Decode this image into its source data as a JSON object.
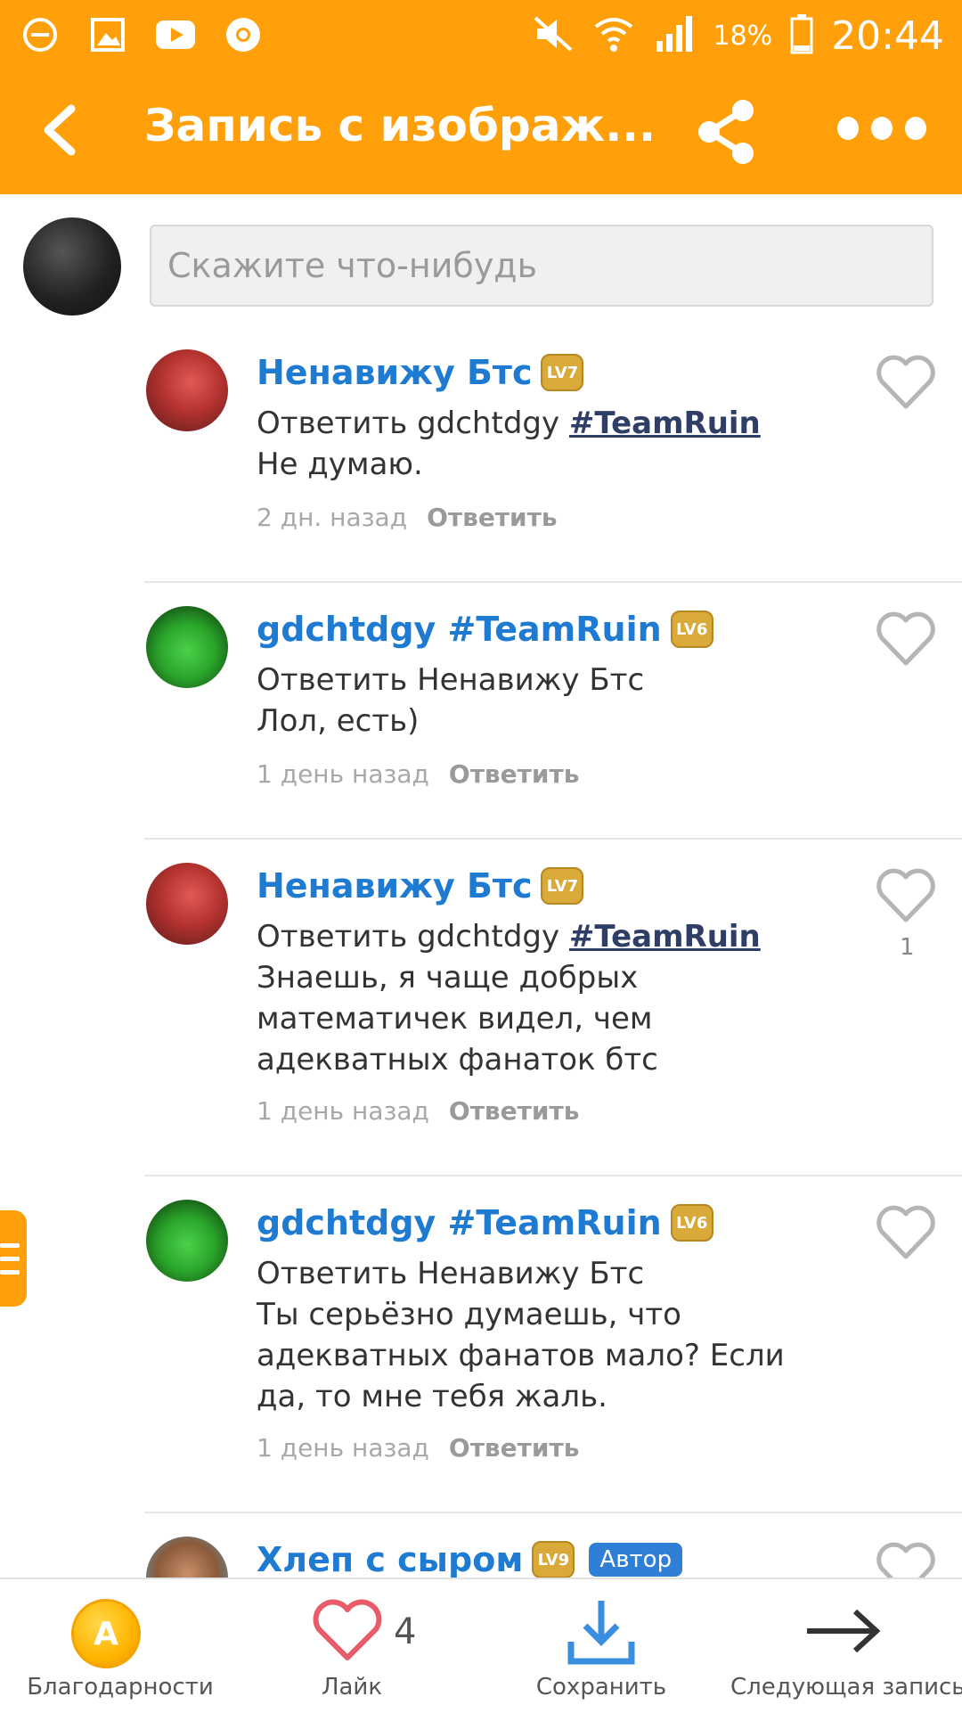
{
  "status_bar": {
    "battery_percent": "18%",
    "time": "20:44",
    "left_icons": [
      "minus-circle-icon",
      "gallery-icon",
      "youtube-icon",
      "chrome-icon"
    ],
    "right_icons": [
      "mute-icon",
      "wifi-icon",
      "signal-icon",
      "battery-icon"
    ]
  },
  "header": {
    "title": "Запись с изображ...",
    "bg_color": "#ff9f0a"
  },
  "compose": {
    "placeholder": "Скажите что-нибудь"
  },
  "comments": [
    {
      "author": "Ненавижу Бтс",
      "level": "LV7",
      "reply_prefix": "Ответить gdchtdgy",
      "mention": "#TeamRuin",
      "text": "Не думаю.",
      "time": "2 дн. назад",
      "reply_label": "Ответить",
      "likes": ""
    },
    {
      "author": "gdchtdgy #TeamRuin",
      "level": "LV6",
      "reply_prefix": "Ответить Ненавижу Бтс",
      "mention": "",
      "text": "Лол, есть)",
      "time": "1 день назад",
      "reply_label": "Ответить",
      "likes": ""
    },
    {
      "author": "Ненавижу Бтс",
      "level": "LV7",
      "reply_prefix": "Ответить gdchtdgy",
      "mention": "#TeamRuin",
      "text": "Знаешь, я чаще добрых математичек видел, чем адекватных фанаток бтс",
      "time": "1 день назад",
      "reply_label": "Ответить",
      "likes": "1"
    },
    {
      "author": "gdchtdgy #TeamRuin",
      "level": "LV6",
      "reply_prefix": "Ответить Ненавижу Бтс",
      "mention": "",
      "text": "Ты серьёзно думаешь, что адекватных фанатов мало? Если да, то мне тебя жаль.",
      "time": "1 день назад",
      "reply_label": "Ответить",
      "likes": ""
    },
    {
      "author": "Хлеп с сыром",
      "level": "LV9",
      "badge": "Автор"
    }
  ],
  "bottom_bar": {
    "thanks_label": "Благодарности",
    "like_label": "Лайк",
    "like_count": "4",
    "save_label": "Сохранить",
    "next_label": "Следующая запись"
  }
}
